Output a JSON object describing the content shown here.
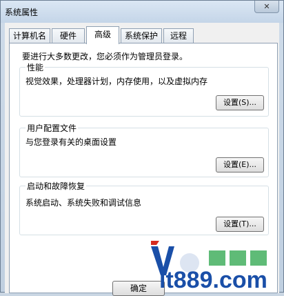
{
  "window": {
    "title": "系统属性",
    "close": "✕"
  },
  "tabs": [
    {
      "label": "计算机名"
    },
    {
      "label": "硬件"
    },
    {
      "label": "高级"
    },
    {
      "label": "系统保护"
    },
    {
      "label": "远程"
    }
  ],
  "note": "要进行大多数更改，您必须作为管理员登录。",
  "groups": {
    "performance": {
      "title": "性能",
      "desc": "视觉效果，处理器计划，内存使用，以及虚拟内存",
      "button": "设置(S)..."
    },
    "profiles": {
      "title": "用户配置文件",
      "desc": "与您登录有关的桌面设置",
      "button": "设置(E)..."
    },
    "startup": {
      "title": "启动和故障恢复",
      "desc": "系统启动、系统失败和调试信息",
      "button": "设置(T)..."
    }
  },
  "footer": {
    "ok": "确定"
  },
  "watermark": {
    "text": "it889.com",
    "colors": {
      "main": "#1a4fa8",
      "accent": "#d62b1f"
    }
  }
}
